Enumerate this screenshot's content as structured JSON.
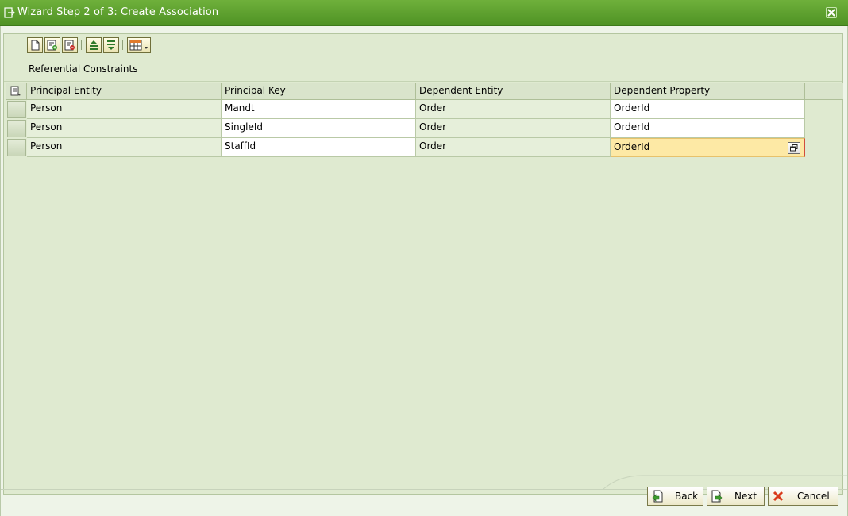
{
  "window": {
    "title": "Wizard Step 2 of 3: Create Association"
  },
  "toolbar": {
    "buttons": [
      "new-entry-icon",
      "insert-row-icon",
      "delete-row-icon",
      "sort-ascending-icon",
      "filter-icon",
      "layout-icon"
    ]
  },
  "section": {
    "label": "Referential Constraints"
  },
  "table": {
    "columns": [
      "Principal Entity",
      "Principal Key",
      "Dependent Entity",
      "Dependent Property"
    ],
    "rows": [
      [
        "Person",
        "Mandt",
        "Order",
        "OrderId"
      ],
      [
        "Person",
        "SingleId",
        "Order",
        "OrderId"
      ],
      [
        "Person",
        "StaffId",
        "Order",
        "OrderId"
      ]
    ],
    "focused_cell": {
      "row": 2,
      "column": 3
    }
  },
  "footer": {
    "back_label": "Back",
    "next_label": "Next",
    "cancel_label": "Cancel"
  },
  "colors": {
    "titlebar": "#5aa02e",
    "content_bg": "#dfead0",
    "focus_cell": "#fde9a5"
  }
}
